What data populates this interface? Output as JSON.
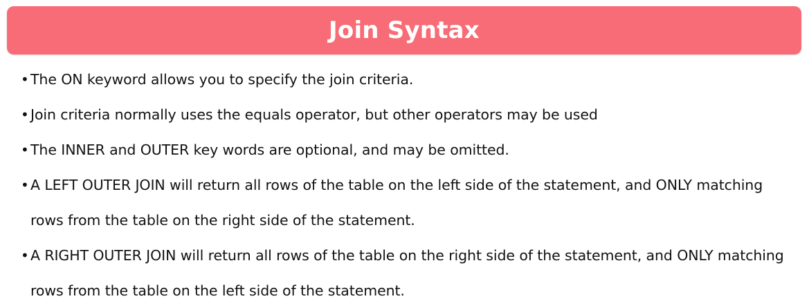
{
  "slide": {
    "title": "Join Syntax",
    "title_bar_color": "#f76c76",
    "bullet_glyph": "•",
    "bullets": [
      "The ON keyword allows you to specify the join criteria.",
      "Join criteria normally uses the equals operator, but other operators may be used",
      "The INNER and OUTER key words are optional, and may be omitted.",
      "A LEFT OUTER JOIN will return all rows of the table on the left side of the statement, and ONLY matching rows from the table on the right side of the statement.",
      "A RIGHT OUTER JOIN will return all rows of the table on the right side of the statement, and ONLY matching rows from the table on the left side of the statement."
    ]
  }
}
